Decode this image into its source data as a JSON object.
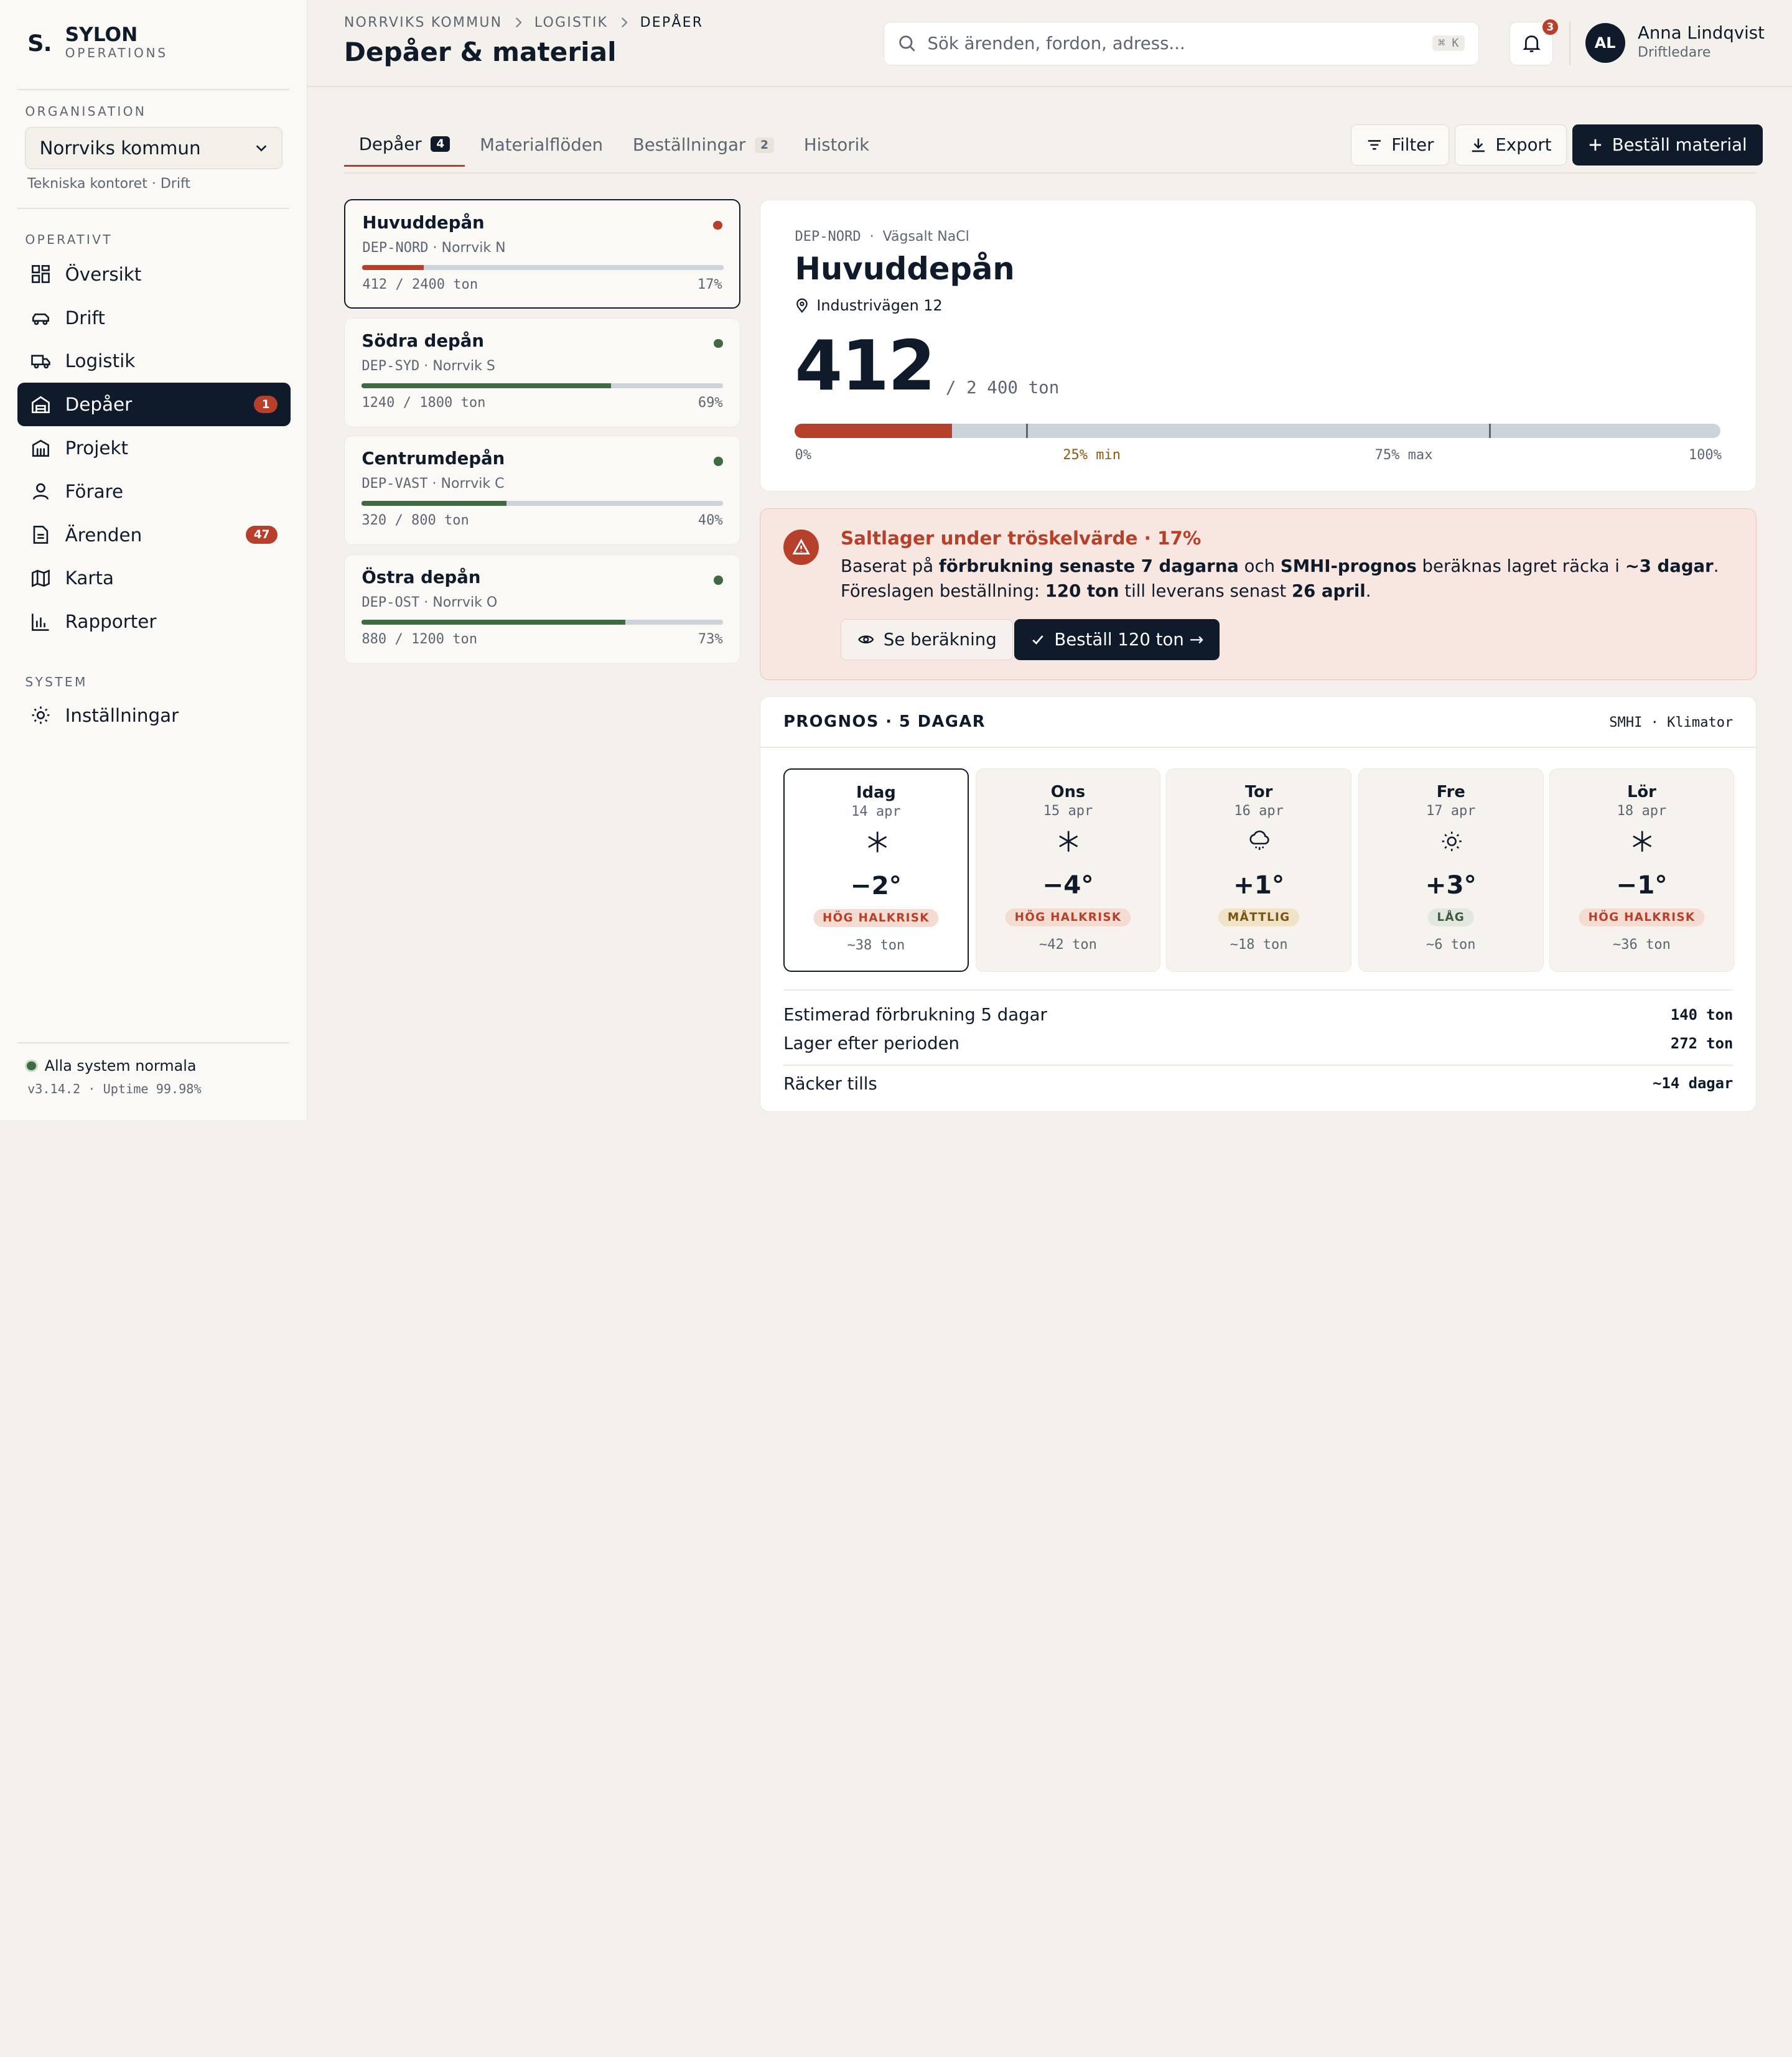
{
  "brand": {
    "mark": "S.",
    "name": "SYLON",
    "sub": "OPERATIONS"
  },
  "org": {
    "section_label": "ORGANISATION",
    "selected": "Norrviks kommun",
    "note": "Tekniska kontoret · Drift"
  },
  "nav": {
    "section_operativt": "OPERATIVT",
    "section_system": "SYSTEM",
    "items": [
      {
        "label": "Översikt",
        "icon": "grid-icon"
      },
      {
        "label": "Drift",
        "icon": "car-icon"
      },
      {
        "label": "Logistik",
        "icon": "truck-icon"
      },
      {
        "label": "Depåer",
        "icon": "warehouse-icon",
        "badge": "1",
        "active": true
      },
      {
        "label": "Projekt",
        "icon": "building-icon"
      },
      {
        "label": "Förare",
        "icon": "user-icon"
      },
      {
        "label": "Ärenden",
        "icon": "document-icon",
        "badge": "47"
      },
      {
        "label": "Karta",
        "icon": "map-icon"
      },
      {
        "label": "Rapporter",
        "icon": "bar-chart-icon"
      }
    ],
    "settings": {
      "label": "Inställningar",
      "icon": "gear-icon"
    }
  },
  "footer": {
    "status": "Alla system normala",
    "version": "v3.14.2 · Uptime 99.98%"
  },
  "header": {
    "breadcrumb": [
      "NORRVIKS KOMMUN",
      "LOGISTIK",
      "DEPÅER"
    ],
    "title": "Depåer & material",
    "search_placeholder": "Sök ärenden, fordon, adress...",
    "search_shortcut": "⌘ K",
    "notification_count": "3",
    "user": {
      "initials": "AL",
      "name": "Anna Lindqvist",
      "role": "Driftledare"
    }
  },
  "tabs": [
    {
      "label": "Depåer",
      "count": "4",
      "active": true
    },
    {
      "label": "Materialflöden"
    },
    {
      "label": "Beställningar",
      "count": "2"
    },
    {
      "label": "Historik"
    }
  ],
  "actions": {
    "filter": "Filter",
    "export": "Export",
    "order": "Beställ material"
  },
  "depots": [
    {
      "name": "Huvuddepån",
      "code": "DEP-NORD",
      "area": "Norrvik N",
      "amount": "412 / 2400 ton",
      "pct": "17%",
      "fill": 0.17,
      "color": "#b6402a"
    },
    {
      "name": "Södra depån",
      "code": "DEP-SYD",
      "area": "Norrvik S",
      "amount": "1240 / 1800 ton",
      "pct": "69%",
      "fill": 0.69,
      "color": "#3f6b42"
    },
    {
      "name": "Centrumdepån",
      "code": "DEP-VAST",
      "area": "Norrvik C",
      "amount": "320 / 800 ton",
      "pct": "40%",
      "fill": 0.4,
      "color": "#3f6b42"
    },
    {
      "name": "Östra depån",
      "code": "DEP-OST",
      "area": "Norrvik O",
      "amount": "880 / 1200 ton",
      "pct": "73%",
      "fill": 0.73,
      "color": "#3f6b42"
    }
  ],
  "detail": {
    "code": "DEP-NORD",
    "material": "Vägsalt NaCl",
    "name": "Huvuddepån",
    "address": "Industrivägen 12",
    "amount": "412",
    "capacity": "/ 2 400 ton",
    "fill": 0.17,
    "min": 0.25,
    "max": 0.75,
    "labels": {
      "start": "0%",
      "min": "25% min",
      "max": "75% max",
      "end": "100%"
    }
  },
  "alert": {
    "title": "Saltlager under tröskelvärde · 17%",
    "line1": [
      "Baserat på ",
      "förbrukning senaste 7 dagarna",
      " och ",
      "SMHI-prognos",
      " beräknas lagret räcka i ",
      "~3 dagar",
      "."
    ],
    "line2": [
      "Föreslagen beställning: ",
      "120 ton",
      " till leverans senast ",
      "26 april",
      "."
    ],
    "btn_secondary": "Se beräkning",
    "btn_primary": "Beställ 120 ton →"
  },
  "forecast": {
    "title": "PROGNOS · 5 DAGAR",
    "source": "SMHI · Klimator",
    "days": [
      {
        "name": "Idag",
        "date": "14 apr",
        "icon": "snowflake-icon",
        "temp": "−2°",
        "risk": "HÖG HALKRISK",
        "level": "high",
        "use": "~38 ton"
      },
      {
        "name": "Ons",
        "date": "15 apr",
        "icon": "snowflake-icon",
        "temp": "−4°",
        "risk": "HÖG HALKRISK",
        "level": "high",
        "use": "~42 ton"
      },
      {
        "name": "Tor",
        "date": "16 apr",
        "icon": "sleet-cloud-icon",
        "temp": "+1°",
        "risk": "MÅTTLIG",
        "level": "medium",
        "use": "~18 ton"
      },
      {
        "name": "Fre",
        "date": "17 apr",
        "icon": "sun-icon",
        "temp": "+3°",
        "risk": "LÅG",
        "level": "low",
        "use": "~6 ton"
      },
      {
        "name": "Lör",
        "date": "18 apr",
        "icon": "snowflake-icon",
        "temp": "−1°",
        "risk": "HÖG HALKRISK",
        "level": "high",
        "use": "~36 ton"
      }
    ],
    "summary": [
      {
        "label": "Estimerad förbrukning 5 dagar",
        "value": "140 ton"
      },
      {
        "label": "Lager efter perioden",
        "value": "272 ton"
      },
      {
        "label": "Räcker tills",
        "value": "~14 dagar"
      }
    ]
  },
  "colors": {
    "navy": "#0f1b2a",
    "accent": "#b6402a",
    "ok": "#3f6b42",
    "bg": "#f4f1ec"
  }
}
